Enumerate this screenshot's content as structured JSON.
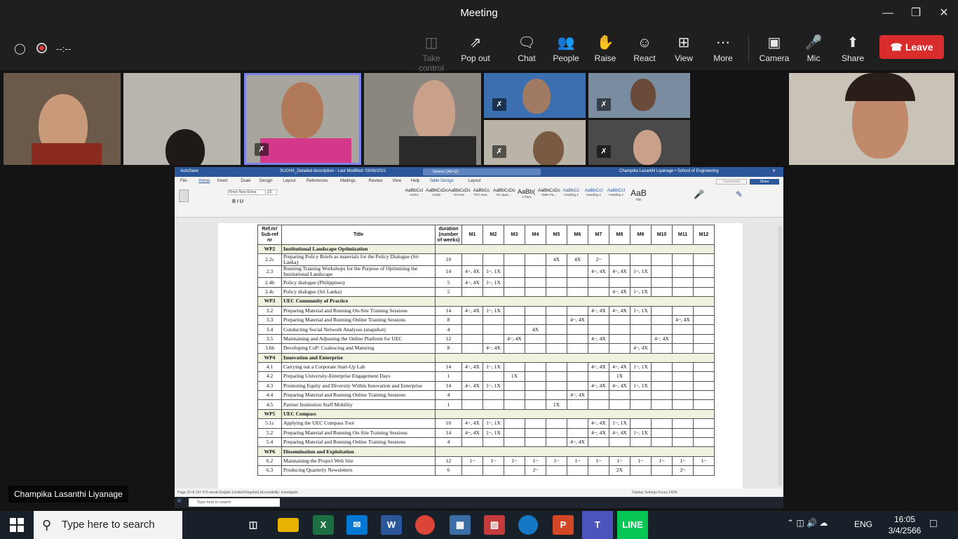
{
  "window": {
    "title": "Meeting"
  },
  "toolbar": {
    "timer": "--:--",
    "buttons": [
      {
        "label": "Take control",
        "icon": "take-control-icon"
      },
      {
        "label": "Pop out",
        "icon": "pop-out-icon"
      },
      {
        "label": "Chat",
        "icon": "chat-icon"
      },
      {
        "label": "People",
        "icon": "people-icon"
      },
      {
        "label": "Raise",
        "icon": "raise-hand-icon"
      },
      {
        "label": "React",
        "icon": "react-icon"
      },
      {
        "label": "View",
        "icon": "view-icon"
      },
      {
        "label": "More",
        "icon": "more-icon"
      },
      {
        "label": "Camera",
        "icon": "camera-icon"
      },
      {
        "label": "Mic",
        "icon": "mic-off-icon"
      },
      {
        "label": "Share",
        "icon": "share-icon"
      }
    ],
    "leave_label": "Leave"
  },
  "active_speaker": "Champika Lasanthi Liyanage",
  "word": {
    "title": "SUCHA_Detailed description - Last Modified: 03/06/2021",
    "search": "Search (Alt+Q)",
    "user": "Champika Lasanthi Liyanage • School of Engineering",
    "menu": [
      "File",
      "Home",
      "Insert",
      "Draw",
      "Design",
      "Layout",
      "References",
      "Mailings",
      "Review",
      "View",
      "Help",
      "Table Design",
      "Layout"
    ],
    "share_label": "Share",
    "comments_label": "Comments",
    "styles": [
      "AaBbCcI",
      "AaBbCcDc",
      "AaBbCcDc",
      "AaBbCc",
      "AaBbCcDc",
      "AaBb(",
      "AaBbCcDc",
      "AaBbCc",
      "AaBbCcI",
      "AaBbCcI",
      "AaB"
    ],
    "style_names": [
      "Author",
      "Guide",
      "Normal",
      "TOC Hea...",
      "No Spac...",
      "1 Para",
      "Table Pa...",
      "Heading 2",
      "Heading 3",
      "Heading 4",
      "Title"
    ],
    "status_left": "Page 23 of 147    473 words    English (United Kingdom)    Accessibility: Investigate",
    "status_right": "Display Settings   Focus   140%",
    "task_search": "Type here to search"
  },
  "table": {
    "headers": [
      "Ref.nr/ Sub-ref nr",
      "Title",
      "duration (number of weeks)",
      "M1",
      "M2",
      "M3",
      "M4",
      "M5",
      "M6",
      "M7",
      "M8",
      "M9",
      "M10",
      "M11",
      "M12"
    ],
    "rows": [
      {
        "wp": true,
        "ref": "WP2",
        "title": "Institutional Landscape Optimization"
      },
      {
        "ref": "2.2c",
        "title": "Preparing Policy Briefs as materials for the Policy Dialogue (Sri Lanka)",
        "dur": "10",
        "m": [
          "",
          "",
          "",
          "",
          "4X",
          "4X",
          "2~",
          "",
          "",
          "",
          "",
          ""
        ]
      },
      {
        "ref": "2.3",
        "title": "Running Training Workshops for the Purpose of Optimizing the Institutional Landscape",
        "dur": "14",
        "m": [
          "4~, 4X",
          "1~, 1X",
          "",
          "",
          "",
          "",
          "4~, 4X",
          "4~, 4X",
          "1~, 1X",
          "",
          "",
          ""
        ]
      },
      {
        "ref": "2.4b",
        "title": "Policy dialogue (Philippines)",
        "dur": "5",
        "m": [
          "4~, 4X",
          "1~, 1X",
          "",
          "",
          "",
          "",
          "",
          "",
          "",
          "",
          "",
          ""
        ]
      },
      {
        "ref": "2.4c",
        "title": "Policy dialogue (Sri Lanka)",
        "dur": "5",
        "m": [
          "",
          "",
          "",
          "",
          "",
          "",
          "",
          "4~, 4X",
          "1~, 1X",
          "",
          "",
          ""
        ]
      },
      {
        "wp": true,
        "ref": "WP3",
        "title": "UEC Community of Practice"
      },
      {
        "ref": "3.2",
        "title": "Preparing Material and Running On-Site Training Sessions",
        "dur": "14",
        "m": [
          "4~, 4X",
          "1~, 1X",
          "",
          "",
          "",
          "",
          "4~, 4X",
          "4~, 4X",
          "1~, 1X",
          "",
          "",
          ""
        ]
      },
      {
        "ref": "3.3",
        "title": "Preparing Material and Running Online Training Sessions",
        "dur": "8",
        "m": [
          "",
          "",
          "",
          "",
          "",
          "4~, 4X",
          "",
          "",
          "",
          "",
          "4~, 4X",
          ""
        ]
      },
      {
        "ref": "3.4",
        "title": "Conducting Social Network Analyses (snapshot)",
        "dur": "4",
        "m": [
          "",
          "",
          "",
          "4X",
          "",
          "",
          "",
          "",
          "",
          "",
          "",
          ""
        ]
      },
      {
        "ref": "3.5",
        "title": "Maintaining and Adjusting the Online Platform for UEC",
        "dur": "12",
        "m": [
          "",
          "",
          "4~, 4X",
          "",
          "",
          "",
          "4~, 4X",
          "",
          "",
          "4~, 4X",
          "",
          ""
        ]
      },
      {
        "ref": "3.6b",
        "title": "Developing CoP: Coalescing and Maturing",
        "dur": "8",
        "m": [
          "",
          "4~, 4X",
          "",
          "",
          "",
          "",
          "",
          "",
          "4~, 4X",
          "",
          "",
          ""
        ]
      },
      {
        "wp": true,
        "ref": "WP4",
        "title": "Innovation and Enterprise"
      },
      {
        "ref": "4.1",
        "title": "Carrying out a Corporate Start-Up Lab",
        "dur": "14",
        "m": [
          "4~, 4X",
          "1~, 1X",
          "",
          "",
          "",
          "",
          "4~, 4X",
          "4~, 4X",
          "1~, 1X",
          "",
          "",
          ""
        ]
      },
      {
        "ref": "4.2",
        "title": "Preparing University-Enterprise Engagement Days",
        "dur": "1",
        "m": [
          "",
          "",
          "1X",
          "",
          "",
          "",
          "",
          "1X",
          "",
          "",
          "",
          ""
        ]
      },
      {
        "ref": "4.3",
        "title": "Promoting Equity and Diversity Within Innovation and Enterprise",
        "dur": "14",
        "m": [
          "4~, 4X",
          "1~, 1X",
          "",
          "",
          "",
          "",
          "4~, 4X",
          "4~, 4X",
          "1~, 1X",
          "",
          "",
          ""
        ]
      },
      {
        "ref": "4.4",
        "title": "Preparing Material and Running Online Training Sessions",
        "dur": "4",
        "m": [
          "",
          "",
          "",
          "",
          "",
          "4~, 4X",
          "",
          "",
          "",
          "",
          "",
          ""
        ]
      },
      {
        "ref": "4.5",
        "title": "Partner Institution Staff Mobility",
        "dur": "1",
        "m": [
          "",
          "",
          "",
          "",
          "1X",
          "",
          "",
          "",
          "",
          "",
          "",
          ""
        ]
      },
      {
        "wp": true,
        "ref": "WP5",
        "title": "UEC Compass"
      },
      {
        "ref": "5.1c",
        "title": "Applying the UEC Compass Tool",
        "dur": "10",
        "m": [
          "4~, 4X",
          "1~, 1X",
          "",
          "",
          "",
          "",
          "4~, 4X",
          "1~, 1X",
          "",
          "",
          "",
          ""
        ]
      },
      {
        "ref": "5.2",
        "title": "Preparing Material and Running On-Site Training Sessions",
        "dur": "14",
        "m": [
          "4~, 4X",
          "1~, 1X",
          "",
          "",
          "",
          "",
          "4~, 4X",
          "4~, 4X",
          "1~, 1X",
          "",
          "",
          ""
        ]
      },
      {
        "ref": "5.4",
        "title": "Preparing Material and Running Online Training Sessions",
        "dur": "4",
        "m": [
          "",
          "",
          "",
          "",
          "",
          "4~, 4X",
          "",
          "",
          "",
          "",
          "",
          ""
        ]
      },
      {
        "wp": true,
        "ref": "WP6",
        "title": "Dissemination and Exploitation"
      },
      {
        "ref": "6.2",
        "title": "Maintaining the Project Web Site",
        "dur": "12",
        "m": [
          "1~",
          "1~",
          "1~",
          "1~",
          "1~",
          "1~",
          "1~",
          "1~",
          "1~",
          "1~",
          "1~",
          "1~"
        ]
      },
      {
        "ref": "6.3",
        "title": "Producing Quarterly Newsletters",
        "dur": "6",
        "m": [
          "",
          "",
          "",
          "2~",
          "",
          "",
          "",
          "2X",
          "",
          "",
          "2~",
          ""
        ]
      }
    ]
  },
  "taskbar": {
    "search_placeholder": "Type here to search",
    "language": "ENG",
    "time": "16:05",
    "date": "3/4/2566"
  }
}
